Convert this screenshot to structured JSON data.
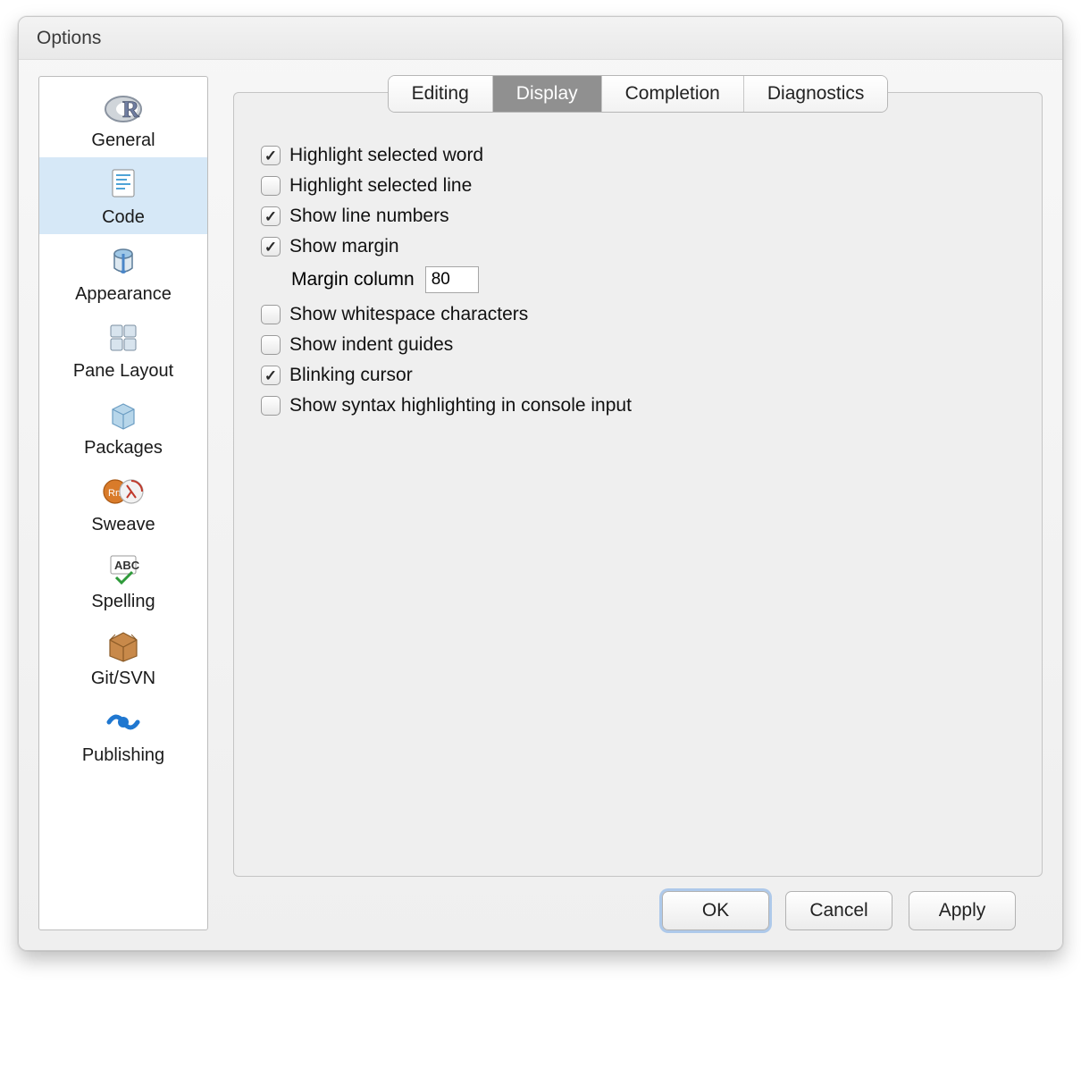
{
  "window": {
    "title": "Options"
  },
  "sidebar": {
    "items": [
      {
        "label": "General",
        "selected": false
      },
      {
        "label": "Code",
        "selected": true
      },
      {
        "label": "Appearance",
        "selected": false
      },
      {
        "label": "Pane Layout",
        "selected": false
      },
      {
        "label": "Packages",
        "selected": false
      },
      {
        "label": "Sweave",
        "selected": false
      },
      {
        "label": "Spelling",
        "selected": false
      },
      {
        "label": "Git/SVN",
        "selected": false
      },
      {
        "label": "Publishing",
        "selected": false
      }
    ]
  },
  "tabs": {
    "items": [
      {
        "label": "Editing",
        "active": false
      },
      {
        "label": "Display",
        "active": true
      },
      {
        "label": "Completion",
        "active": false
      },
      {
        "label": "Diagnostics",
        "active": false
      }
    ]
  },
  "options": {
    "highlight_selected_word": {
      "label": "Highlight selected word",
      "checked": true
    },
    "highlight_selected_line": {
      "label": "Highlight selected line",
      "checked": false
    },
    "show_line_numbers": {
      "label": "Show line numbers",
      "checked": true
    },
    "show_margin": {
      "label": "Show margin",
      "checked": true
    },
    "margin_column_label": "Margin column",
    "margin_column_value": "80",
    "show_whitespace_chars": {
      "label": "Show whitespace characters",
      "checked": false
    },
    "show_indent_guides": {
      "label": "Show indent guides",
      "checked": false
    },
    "blinking_cursor": {
      "label": "Blinking cursor",
      "checked": true
    },
    "syntax_highlight_console": {
      "label": "Show syntax highlighting in console input",
      "checked": false
    }
  },
  "buttons": {
    "ok": "OK",
    "cancel": "Cancel",
    "apply": "Apply"
  }
}
